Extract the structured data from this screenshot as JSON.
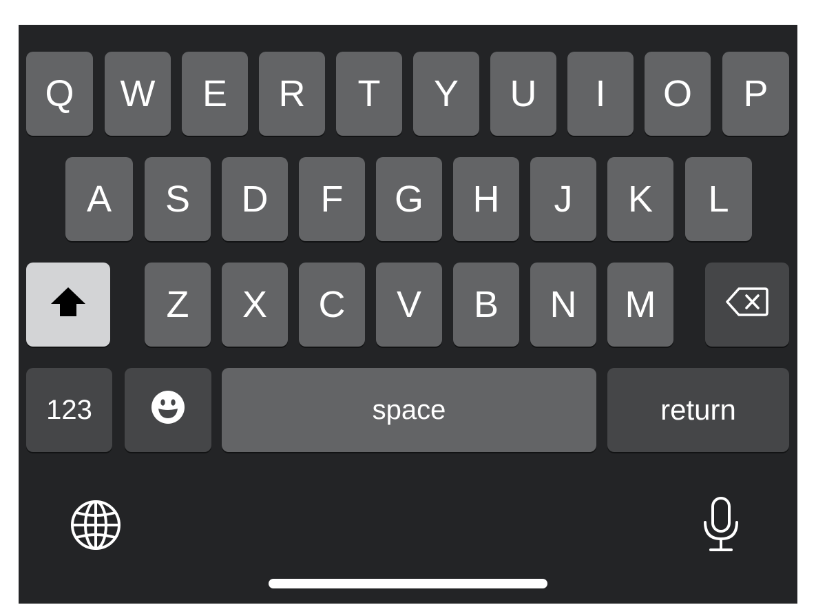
{
  "keyboard": {
    "row1": [
      "Q",
      "W",
      "E",
      "R",
      "T",
      "Y",
      "U",
      "I",
      "O",
      "P"
    ],
    "row2": [
      "A",
      "S",
      "D",
      "F",
      "G",
      "H",
      "J",
      "K",
      "L"
    ],
    "row3": [
      "Z",
      "X",
      "C",
      "V",
      "B",
      "N",
      "M"
    ],
    "numbers_label": "123",
    "space_label": "space",
    "return_label": "return",
    "shift_icon": "shift-arrow-icon",
    "delete_icon": "backspace-icon",
    "emoji_icon": "emoji-smile-icon",
    "globe_icon": "globe-icon",
    "mic_icon": "microphone-icon"
  },
  "colors": {
    "background": "#232426",
    "key": "#636466",
    "key_dark": "#454648",
    "key_light": "#d3d4d6",
    "text": "#ffffff"
  }
}
